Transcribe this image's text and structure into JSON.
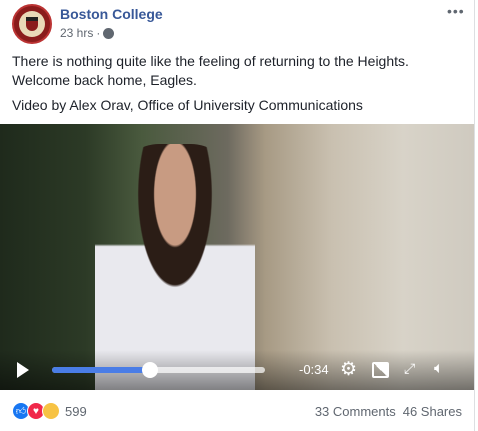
{
  "post": {
    "author": "Boston College",
    "time": "23 hrs",
    "separator": "·",
    "message_lines": [
      "There is nothing quite like the feeling of returning to the Heights.",
      "Welcome back home, Eagles."
    ],
    "credit": "Video by Alex Orav, Office of University Communications",
    "more_label": "•••"
  },
  "video": {
    "progress_percent": 46,
    "time_remaining": "-0:34",
    "accent": "#4a7de6"
  },
  "footer": {
    "reactions": [
      "like",
      "love",
      "sad"
    ],
    "reaction_count": "599",
    "comments": "33 Comments",
    "shares": "46 Shares"
  }
}
